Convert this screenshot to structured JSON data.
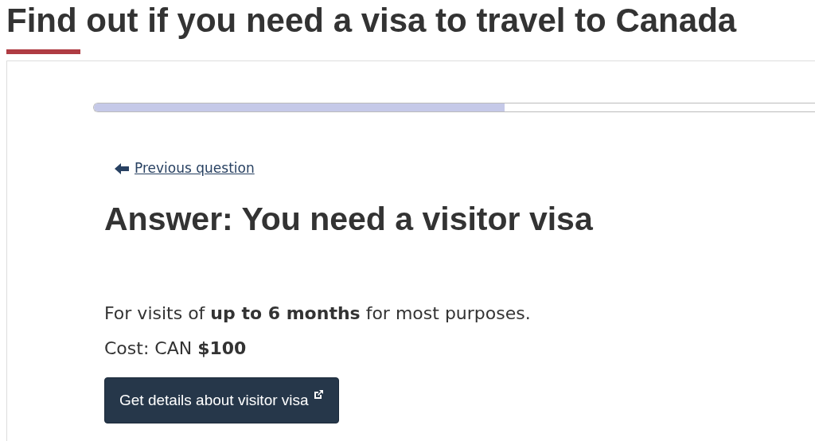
{
  "page_title": "Find out if you need a visa to travel to Canada",
  "progress": {
    "level": 0.57
  },
  "back_link": "Previous question",
  "answer_heading": "Answer: You need a visitor visa",
  "details": [
    "For visits of **up to 6 months** for most purposes.",
    "Cost: CAN **$100**"
  ],
  "button": "Get details about visitor visa"
}
